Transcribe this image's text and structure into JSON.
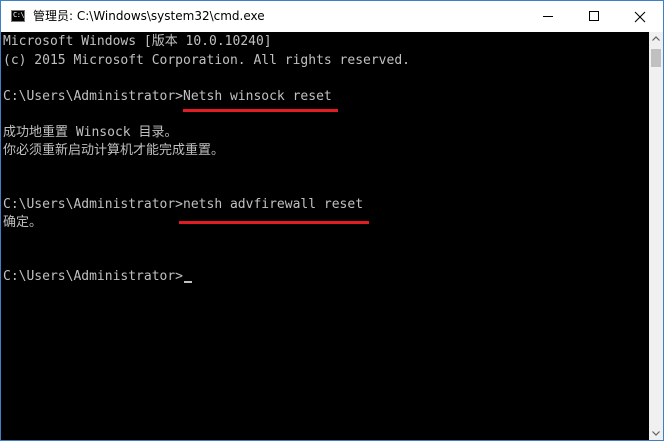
{
  "window": {
    "title": "管理员: C:\\Windows\\system32\\cmd.exe",
    "icon": "cmd-icon",
    "icon_glyph": "C:\\",
    "buttons": {
      "minimize": "minimize-icon",
      "maximize": "maximize-icon",
      "close": "close-icon"
    }
  },
  "console": {
    "banner_line1": "Microsoft Windows [版本 10.0.10240]",
    "banner_line2": "(c) 2015 Microsoft Corporation. All rights reserved.",
    "prompt1": "C:\\Users\\Administrator>",
    "command1": "Netsh winsock reset",
    "output1_line1": "成功地重置 Winsock 目录。",
    "output1_line2": "你必须重新启动计算机才能完成重置。",
    "prompt2": "C:\\Users\\Administrator>",
    "command2": "netsh advfirewall reset",
    "output2_line1": "确定。",
    "prompt3": "C:\\Users\\Administrator>"
  },
  "colors": {
    "console_background": "#000000",
    "console_text": "#c0c0c0",
    "highlight_underline": "#e31b23",
    "window_border": "#3c80c6"
  }
}
